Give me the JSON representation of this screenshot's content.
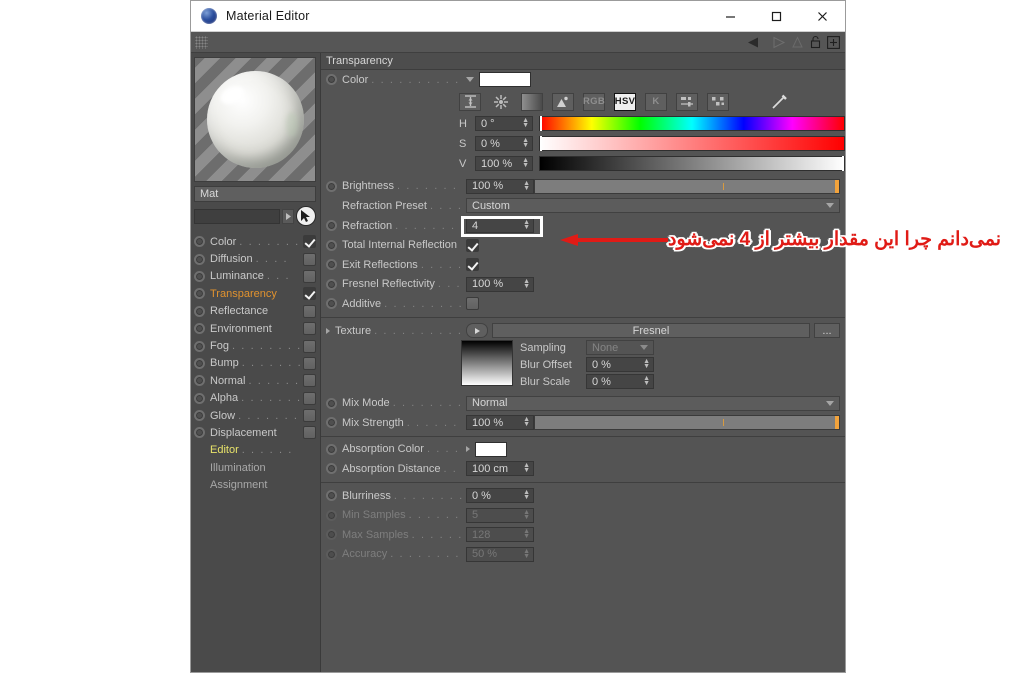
{
  "window": {
    "title": "Material Editor",
    "icon": "material-sphere-icon",
    "minimize": "–",
    "maximize": "□",
    "close": "×"
  },
  "toolbar": {
    "grip": "drag-grip",
    "icons": [
      "back-arrow-icon",
      "forward-arrow-icon",
      "up-arrow-icon",
      "lock-icon",
      "add-icon"
    ]
  },
  "left_panel": {
    "preview_label": "material-preview",
    "material_name": "Mat",
    "search_value": "",
    "arrow_button": "▸",
    "cursor_icon": "cursor-pick-icon",
    "channels": [
      {
        "label": "Color",
        "dots": ". . . . . . .",
        "checked": true,
        "active": false,
        "type": "channel"
      },
      {
        "label": "Diffusion",
        "dots": ". . . .",
        "checked": false,
        "active": false,
        "type": "channel"
      },
      {
        "label": "Luminance",
        "dots": ". . .",
        "checked": false,
        "active": false,
        "type": "channel"
      },
      {
        "label": "Transparency",
        "dots": "",
        "checked": true,
        "active": true,
        "type": "channel"
      },
      {
        "label": "Reflectance",
        "dots": "",
        "checked": false,
        "active": false,
        "type": "channel"
      },
      {
        "label": "Environment",
        "dots": "",
        "checked": false,
        "active": false,
        "type": "channel"
      },
      {
        "label": "Fog",
        "dots": ". . . . . . . . .",
        "checked": false,
        "active": false,
        "type": "channel"
      },
      {
        "label": "Bump",
        "dots": ". . . . . . .",
        "checked": false,
        "active": false,
        "type": "channel"
      },
      {
        "label": "Normal",
        "dots": ". . . . . .",
        "checked": false,
        "active": false,
        "type": "channel"
      },
      {
        "label": "Alpha",
        "dots": ". . . . . . .",
        "checked": false,
        "active": false,
        "type": "channel"
      },
      {
        "label": "Glow",
        "dots": ". . . . . . . .",
        "checked": false,
        "active": false,
        "type": "channel"
      },
      {
        "label": "Displacement",
        "dots": "",
        "checked": false,
        "active": false,
        "type": "channel"
      }
    ],
    "pages": [
      {
        "label": "Editor",
        "dots": ". . . . . .",
        "highlight": true
      },
      {
        "label": "Illumination",
        "dots": "",
        "highlight": false
      },
      {
        "label": "Assignment",
        "dots": "",
        "highlight": false
      }
    ]
  },
  "main": {
    "section_title": "Transparency",
    "color": {
      "label": "Color",
      "dots": ". . . . . . . . . . . . .",
      "swatch_color": "#ffffff",
      "mode_buttons": [
        {
          "name": "range-icon",
          "label": "",
          "active": false
        },
        {
          "name": "color-wheel-icon",
          "label": "",
          "active": false
        },
        {
          "name": "gradient-icon",
          "label": "",
          "active": false
        },
        {
          "name": "image-icon",
          "label": "",
          "active": false
        },
        {
          "name": "rgb-mode",
          "label": "RGB",
          "active": false
        },
        {
          "name": "hsv-mode",
          "label": "HSV",
          "active": true
        },
        {
          "name": "kelvin-mode",
          "label": "K",
          "active": false
        },
        {
          "name": "mixer-icon",
          "label": "",
          "active": false
        },
        {
          "name": "swatches-icon",
          "label": "",
          "active": false
        },
        {
          "name": "eyedropper-icon",
          "label": "",
          "active": false
        }
      ],
      "channels": [
        {
          "label": "H",
          "value": "0 °",
          "marker_pos": "0%"
        },
        {
          "label": "S",
          "value": "0 %",
          "marker_pos": "0%"
        },
        {
          "label": "V",
          "value": "100 %",
          "marker_pos": "100%"
        }
      ]
    },
    "brightness": {
      "label": "Brightness",
      "dots": ". . . . . . . . . . .",
      "value": "100 %"
    },
    "refraction_preset": {
      "label": "Refraction Preset",
      "dots": ". . . . . .",
      "value": "Custom"
    },
    "refraction": {
      "label": "Refraction",
      "dots": ". . . . . . . . . . .",
      "value": "4",
      "highlighted": true
    },
    "total_internal_reflection": {
      "label": "Total Internal Reflection",
      "dots": "",
      "checked": true
    },
    "exit_reflections": {
      "label": "Exit Reflections",
      "dots": ". . . . . . . .",
      "checked": true
    },
    "fresnel_reflectivity": {
      "label": "Fresnel Reflectivity",
      "dots": ". . . . .",
      "value": "100 %"
    },
    "additive": {
      "label": "Additive",
      "dots": ". . . . . . . . . . . . .",
      "checked": false
    },
    "texture": {
      "label": "Texture",
      "dots": ". . . . . . . . . . . . . .",
      "shader": "Fresnel",
      "browse_label": "...",
      "play_icon": "play-icon",
      "sampling": {
        "label": "Sampling",
        "value": "None"
      },
      "blur_offset": {
        "label": "Blur Offset",
        "value": "0 %"
      },
      "blur_scale": {
        "label": "Blur Scale",
        "value": "0 %"
      }
    },
    "mix_mode": {
      "label": "Mix Mode",
      "dots": ". . . . . . . . . . . .",
      "value": "Normal"
    },
    "mix_strength": {
      "label": "Mix Strength",
      "dots": ". . . . . . . . . .",
      "value": "100 %"
    },
    "absorption_color": {
      "label": "Absorption Color",
      "dots": ". . . .",
      "swatch_color": "#ffffff"
    },
    "absorption_distance": {
      "label": "Absorption Distance",
      "dots": ". . .",
      "value": "100 cm"
    },
    "blurriness": {
      "label": "Blurriness",
      "dots": ". . . . . . . . . . . .",
      "value": "0 %"
    },
    "min_samples": {
      "label": "Min Samples",
      "dots": ". . . . . . . . . .",
      "value": "5",
      "disabled": true
    },
    "max_samples": {
      "label": "Max Samples",
      "dots": ". . . . . . . . . .",
      "value": "128",
      "disabled": true
    },
    "accuracy": {
      "label": "Accuracy",
      "dots": ". . . . . . . . . . . . .",
      "value": "50 %",
      "disabled": true
    }
  },
  "annotation": {
    "text": "نمی‌دانم چرا این مقدار بیشتر از 4 نمی‌شود",
    "arrow": "red-left-arrow",
    "color": "#e01b16"
  }
}
